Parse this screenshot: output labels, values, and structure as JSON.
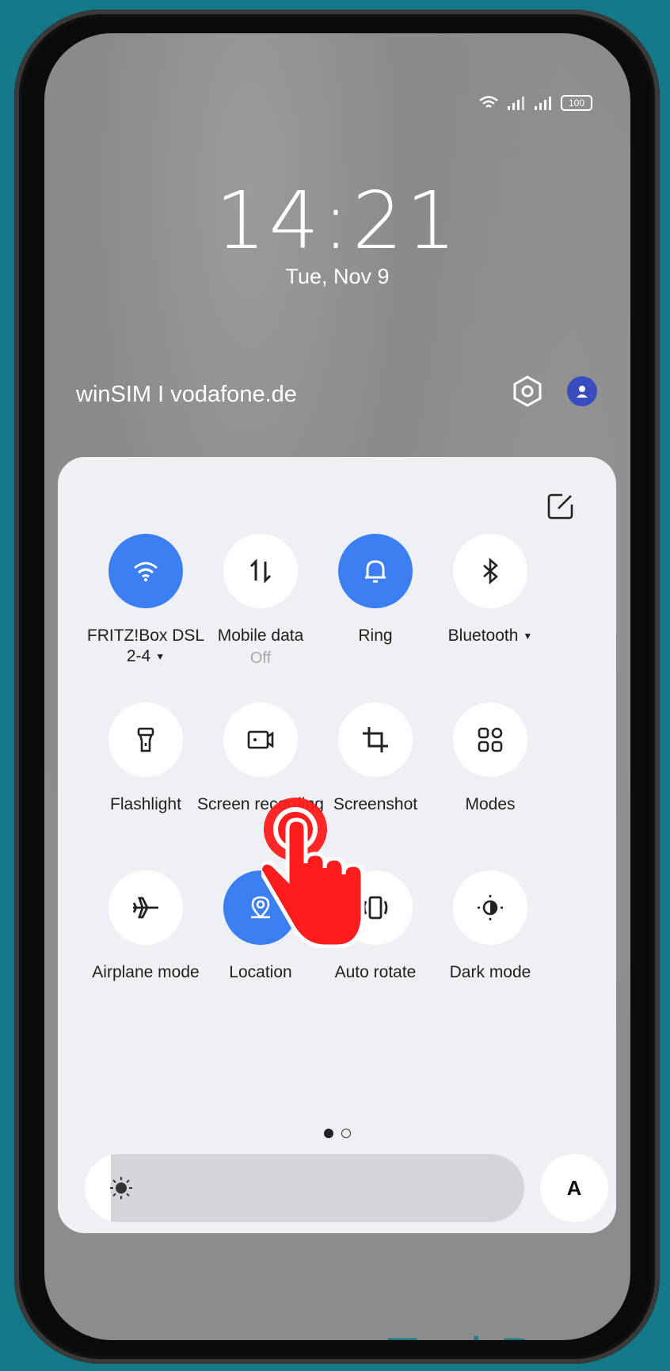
{
  "status_bar": {
    "battery": "100"
  },
  "lockscreen": {
    "time": "14:21",
    "date": "Tue, Nov 9",
    "carrier": "winSIM I vodafone.de"
  },
  "quick_settings": {
    "tiles": [
      {
        "label": "FRITZ!Box DSL 2-4",
        "icon": "wifi-icon",
        "active": true,
        "has_dropdown": true
      },
      {
        "label": "Mobile data",
        "sub": "Off",
        "icon": "mobile-data-icon",
        "active": false
      },
      {
        "label": "Ring",
        "icon": "bell-icon",
        "active": true
      },
      {
        "label": "Bluetooth",
        "icon": "bluetooth-icon",
        "active": false,
        "has_dropdown": true
      },
      {
        "label": "Flashlight",
        "icon": "flashlight-icon",
        "active": false
      },
      {
        "label": "Screen recording",
        "icon": "screen-record-icon",
        "active": false
      },
      {
        "label": "Screenshot",
        "icon": "crop-icon",
        "active": false
      },
      {
        "label": "Modes",
        "icon": "modes-grid-icon",
        "active": false
      },
      {
        "label": "Airplane mode",
        "icon": "airplane-icon",
        "active": false
      },
      {
        "label": "Location",
        "icon": "location-pin-icon",
        "active": true
      },
      {
        "label": "Auto rotate",
        "icon": "auto-rotate-icon",
        "active": false
      },
      {
        "label": "Dark mode",
        "icon": "dark-mode-icon",
        "active": false
      }
    ],
    "page_indicator": {
      "current": 1,
      "total": 2
    },
    "brightness": {
      "level": 0.06,
      "auto_label": "A"
    }
  },
  "watermark": "TechBone",
  "colors": {
    "accent": "#3b7ff2",
    "panel": "#eef0f4",
    "background": "#147a8a",
    "tap_hand": "#ff1c1c"
  }
}
